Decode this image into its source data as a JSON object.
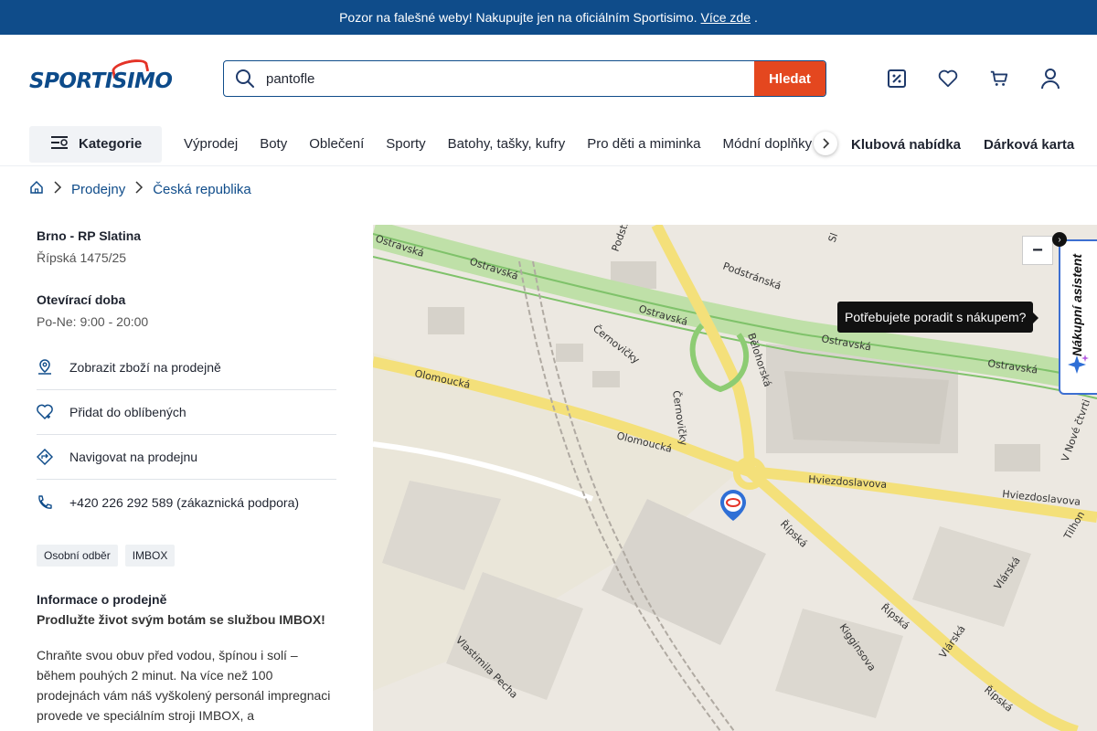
{
  "banner": {
    "text": "Pozor na falešné weby! Nakupujte jen na oficiálním Sportisimo.",
    "link": "Více zde",
    "tail": "."
  },
  "header": {
    "logo": "SPORTISIMO",
    "search": {
      "value": "pantofle",
      "button": "Hledat"
    },
    "icons": [
      "discount-icon",
      "heart-icon",
      "cart-icon",
      "user-icon"
    ]
  },
  "nav": {
    "kategorie": "Kategorie",
    "items": [
      "Výprodej",
      "Boty",
      "Oblečení",
      "Sporty",
      "Batohy, tašky, kufry",
      "Pro děti a miminka",
      "Módní doplňky"
    ],
    "bold": [
      "Klubová nabídka",
      "Dárková karta"
    ]
  },
  "breadcrumb": {
    "items": [
      "Prodejny",
      "Česká republika"
    ]
  },
  "store": {
    "name": "Brno - RP Slatina",
    "address": "Řípská 1475/25",
    "hours_title": "Otevírací doba",
    "hours": "Po-Ne: 9:00 - 20:00",
    "actions": [
      {
        "label": "Zobrazit zboží na prodejně",
        "icon": "location-pin-icon"
      },
      {
        "label": "Přidat do oblíbených",
        "icon": "heart-plus-icon"
      },
      {
        "label": "Navigovat na prodejnu",
        "icon": "directions-icon"
      },
      {
        "label": "+420 226 292 589 (zákaznická podpora)",
        "icon": "phone-icon"
      }
    ],
    "tags": [
      "Osobní odběr",
      "IMBOX"
    ],
    "info_title": "Informace o prodejně",
    "info_bold": "Prodlužte život svým botám se službou IMBOX!",
    "info_text": "Chraňte svou obuv před vodou, špínou i solí – během pouhých 2 minut. Na více než 100 prodejnách vám náš vyškolený personál impregnaci provede ve speciálním stroji IMBOX, a"
  },
  "map": {
    "zoom_out": "−",
    "streets": [
      "Ostravská",
      "Ostravská",
      "Ostravská",
      "Ostravská",
      "Ostravská",
      "Podstránská",
      "Bělohorská",
      "Černovičky",
      "Černovičky",
      "Olomoucká",
      "Olomoucká",
      "Hviezdoslavova",
      "Hviezdoslavova",
      "Řípská",
      "Řípská",
      "Řípská",
      "Kigginsova",
      "Vlárská",
      "Vlárská",
      "Vlastimila Pecha",
      "Tilhon",
      "V Nové čtvrti",
      "Podstr",
      "Sl"
    ]
  },
  "assistant": {
    "tooltip": "Potřebujete poradit s nákupem?",
    "label": "Nákupní asistent",
    "close": "›"
  }
}
